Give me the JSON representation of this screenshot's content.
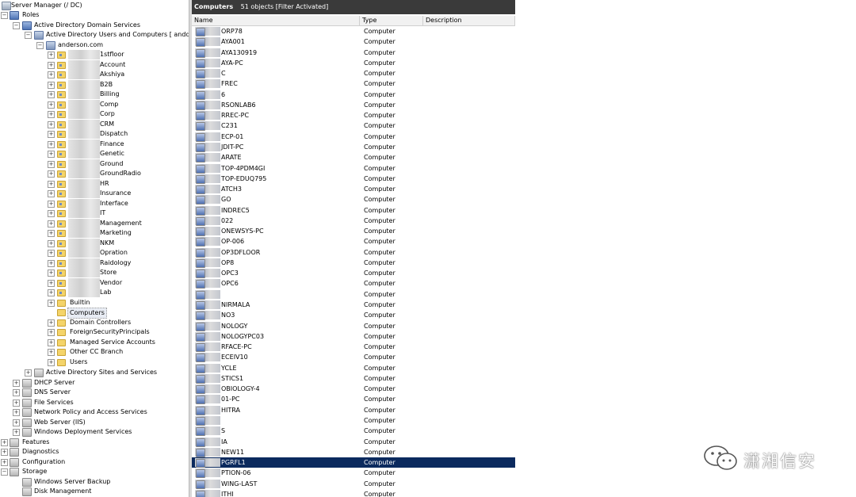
{
  "tree": {
    "server_manager": "Server Manager (/    DC)",
    "roles": "Roles",
    "adds": "Active Directory Domain Services",
    "aduc": "Active Directory Users and Computers [ anddc.a",
    "domain": "anderson.com",
    "ous": [
      "1stfloor",
      "Account",
      "Akshiya",
      "B2B",
      "Billing",
      "Comp",
      "Corp",
      "CRM",
      "Dispatch",
      "Finance",
      "Genetic",
      "Ground",
      "GroundRadio",
      "HR",
      "Insurance",
      "Interface",
      "IT",
      "Management",
      "Marketing",
      "NKM",
      "Opration",
      "Raidology",
      "Store",
      "Vendor",
      "Lab"
    ],
    "containers": [
      "Builtin",
      "Computers",
      "Domain Controllers",
      "ForeignSecurityPrincipals",
      "Managed Service Accounts",
      "Other CC Branch",
      "Users"
    ],
    "ad_sites": "Active Directory Sites and Services",
    "roles_list": [
      "DHCP Server",
      "DNS Server",
      "File Services",
      "Network Policy and Access Services",
      "Web Server (IIS)",
      "Windows Deployment Services"
    ],
    "features": "Features",
    "diagnostics": "Diagnostics",
    "configuration": "Configuration",
    "storage": "Storage",
    "storage_items": [
      "Windows Server Backup",
      "Disk Management"
    ]
  },
  "list": {
    "title": "Computers",
    "count": "51 objects",
    "filter": "[Filter Activated]",
    "columns": [
      "Name",
      "Type",
      "Description"
    ],
    "type_value": "Computer",
    "rows": [
      "ORP78",
      "AYA001",
      "AYA130919",
      "AYA-PC",
      "C",
      "FREC",
      "6",
      "RSONLAB6",
      "RREC-PC",
      "C231",
      "ECP-01",
      "JDIT-PC",
      "ARATE",
      "TOP-4PDM4GI",
      "TOP-EDUQ795",
      "ATCH3",
      "GO",
      "INDREC5",
      "022",
      "ONEWSYS-PC",
      "OP-006",
      "OP3DFLOOR",
      "OP8",
      "OPC3",
      "OPC6",
      "",
      "NIRMALA",
      "NO3",
      "NOLOGY",
      "NOLOGYPC03",
      "RFACE-PC",
      "ECEIV10",
      "YCLE",
      "STICS1",
      "OBIOLOGY-4",
      "01-PC",
      "HITRA",
      "",
      "S",
      "IA",
      "NEW11",
      "PGRFL1",
      "PTION-06",
      "WING-LAST",
      "ITHI"
    ],
    "selected_index": 41
  },
  "watermark": "潇湘信安"
}
